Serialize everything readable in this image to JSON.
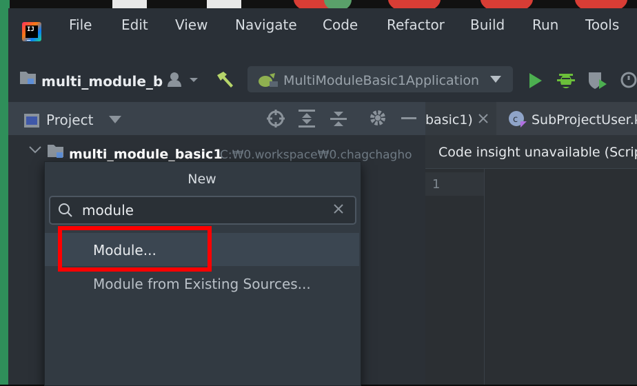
{
  "window": {
    "menu": [
      "File",
      "Edit",
      "View",
      "Navigate",
      "Code",
      "Refactor",
      "Build",
      "Run",
      "Tools"
    ]
  },
  "toolbar": {
    "project_name": "multi_module_b",
    "run_config": "MultiModuleBasic1Application"
  },
  "project_panel": {
    "title": "Project",
    "root_name": "multi_module_basic1",
    "root_path": "C:₩0.workspace₩0.chagchagho"
  },
  "editor": {
    "tabs": [
      "basic1)",
      "SubProjectUser.k"
    ],
    "notice": "Code insight unavailable (Scrip",
    "line_number": "1"
  },
  "new_popup": {
    "title": "New",
    "search_value": "module",
    "items": [
      "Module...",
      "Module from Existing Sources..."
    ]
  },
  "colors": {
    "highlight_box": "#ff0000",
    "run_green": "#4caf50",
    "debug_green": "#6bbf3a"
  }
}
